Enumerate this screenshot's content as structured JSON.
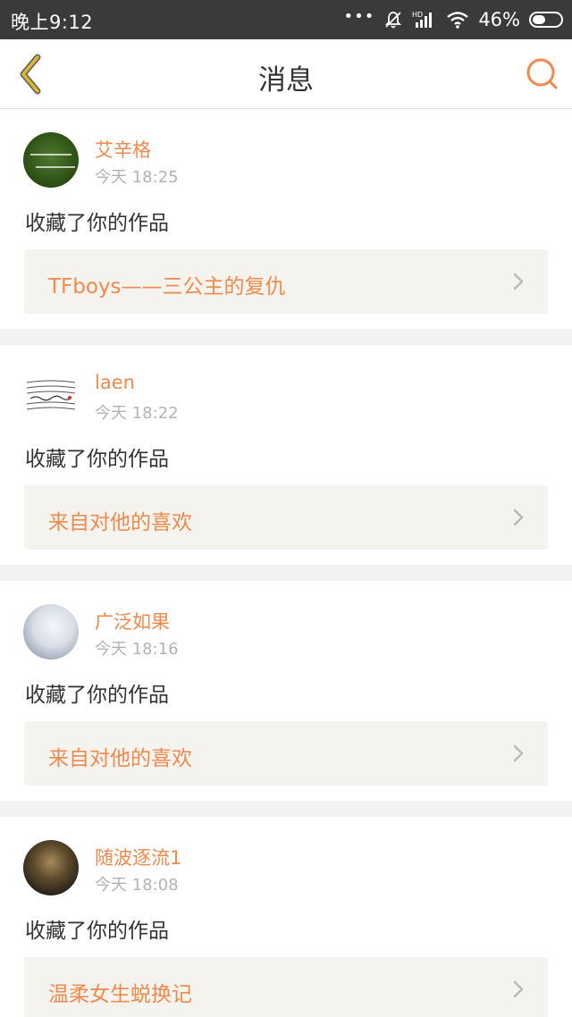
{
  "status_bar": {
    "time": "晚上9:12",
    "dots": "•••",
    "battery_percent": "46%"
  },
  "header": {
    "title": "消息",
    "back_icon": "chevron-left-icon",
    "search_icon": "search-icon"
  },
  "colors": {
    "accent": "#ef8a4d",
    "back_icon": "#e3b62a",
    "search_icon": "#ef8a4d",
    "status_bar_bg": "#3a3a3a"
  },
  "messages": [
    {
      "username": "艾辛格",
      "time": "今天 18:25",
      "action": "收藏了你的作品",
      "work_title": "TFboys——三公主的复仇"
    },
    {
      "username": "laen",
      "time": "今天 18:22",
      "action": "收藏了你的作品",
      "work_title": "来自对他的喜欢"
    },
    {
      "username": "广泛如果",
      "time": "今天 18:16",
      "action": "收藏了你的作品",
      "work_title": "来自对他的喜欢"
    },
    {
      "username": "随波逐流1",
      "time": "今天 18:08",
      "action": "收藏了你的作品",
      "work_title": "温柔女生蜕换记"
    }
  ]
}
